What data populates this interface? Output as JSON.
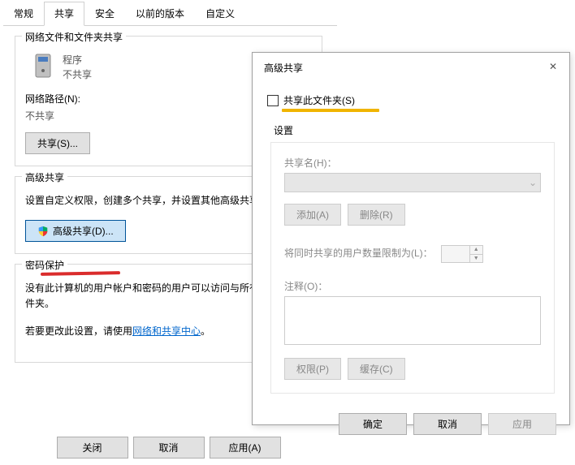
{
  "main": {
    "tabs": [
      {
        "label": "常规"
      },
      {
        "label": "共享"
      },
      {
        "label": "安全"
      },
      {
        "label": "以前的版本"
      },
      {
        "label": "自定义"
      }
    ],
    "section_sharing_title": "网络文件和文件夹共享",
    "folder_name": "程序",
    "folder_status": "不共享",
    "netpath_label": "网络路径(N):",
    "netpath_value": "不共享",
    "share_button": "共享(S)...",
    "section_adv_title": "高级共享",
    "adv_desc": "设置自定义权限，创建多个共享，并设置其他高级共享选项。",
    "adv_share_button": "高级共享(D)...",
    "section_pw_title": "密码保护",
    "pw_desc": "没有此计算机的用户帐户和密码的用户可以访问与所有人共享的文件夹。",
    "pw_change_prefix": "若要更改此设置，请使用",
    "pw_link": "网络和共享中心",
    "pw_suffix": "。",
    "close": "关闭",
    "cancel": "取消",
    "apply": "应用(A)"
  },
  "adv": {
    "title": "高级共享",
    "checkbox_label": "共享此文件夹(S)",
    "settings_label": "设置",
    "share_name_label": "共享名(H)：",
    "add": "添加(A)",
    "remove": "删除(R)",
    "limit_label": "将同时共享的用户数量限制为(L)：",
    "note_label": "注释(O)：",
    "permissions": "权限(P)",
    "cache": "缓存(C)",
    "ok": "确定",
    "cancel": "取消",
    "apply": "应用"
  }
}
